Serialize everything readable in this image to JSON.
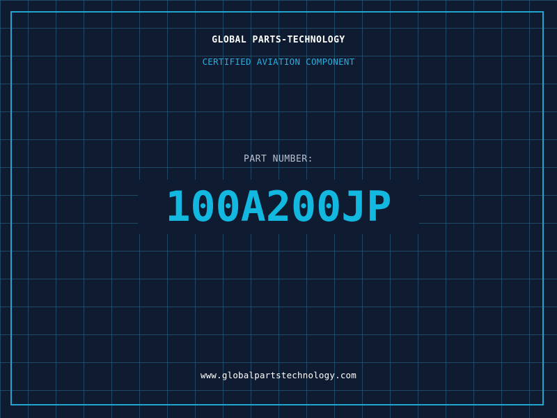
{
  "header": {
    "company_name": "GLOBAL PARTS-TECHNOLOGY",
    "subtitle": "CERTIFIED AVIATION COMPONENT"
  },
  "part": {
    "label": "PART NUMBER:",
    "number": "100A200JP"
  },
  "footer": {
    "website": "www.globalpartstechnology.com"
  },
  "colors": {
    "background": "#0f1b31",
    "grid": "#306e8c",
    "frame": "#22a6cf",
    "accent": "#13b8e0",
    "subtitle": "#27aee0",
    "label": "#b8c1d0",
    "text": "#ffffff"
  }
}
